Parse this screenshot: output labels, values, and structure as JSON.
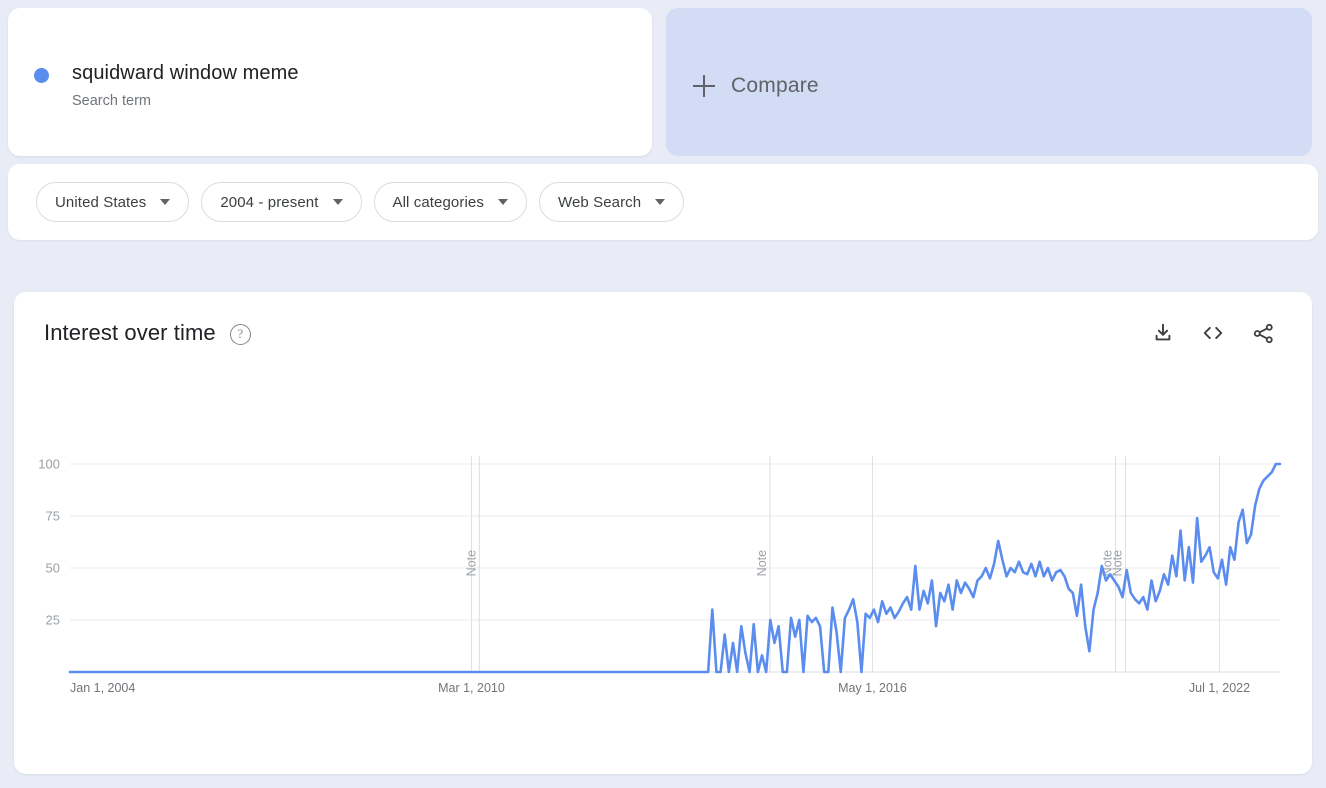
{
  "search_card": {
    "term": "squidward window meme",
    "type_label": "Search term",
    "dot_color": "#5b8def"
  },
  "compare_card": {
    "label": "Compare",
    "plus_icon": "plus-icon",
    "background": "#d2ddf5"
  },
  "filters": [
    {
      "label": "United States",
      "icon": "chevron-down-icon"
    },
    {
      "label": "2004 - present",
      "icon": "chevron-down-icon"
    },
    {
      "label": "All categories",
      "icon": "chevron-down-icon"
    },
    {
      "label": "Web Search",
      "icon": "chevron-down-icon"
    }
  ],
  "chart_card": {
    "title": "Interest over time",
    "help_icon": "help-icon",
    "help_glyph": "?",
    "actions": [
      {
        "name": "download-icon",
        "label": "Download"
      },
      {
        "name": "embed-icon",
        "label": "Embed"
      },
      {
        "name": "share-icon",
        "label": "Share"
      }
    ]
  },
  "chart_data": {
    "type": "line",
    "title": "Interest over time",
    "xlabel": "",
    "ylabel": "",
    "ylim": [
      0,
      100
    ],
    "yticks": [
      25,
      50,
      75,
      100
    ],
    "ytick_labels": [
      "25",
      "50",
      "75",
      "100"
    ],
    "xtick_labels": [
      "Jan 1, 2004",
      "Mar 1, 2010",
      "May 1, 2016",
      "Jul 1, 2022"
    ],
    "xtick_positions": [
      0,
      0.3318,
      0.6632,
      0.95
    ],
    "grid": true,
    "legend": "none",
    "line_color": "#5b8def",
    "line_width": 2.6,
    "annotations": [
      {
        "label": "Note",
        "x_frac": 0.3383
      },
      {
        "label": "Note",
        "x_frac": 0.5785
      },
      {
        "label": "Note",
        "x_frac": 0.8641
      },
      {
        "label": "Note",
        "x_frac": 0.8724
      }
    ],
    "series": [
      {
        "name": "squidward window meme",
        "values": [
          0,
          0,
          0,
          0,
          0,
          0,
          0,
          0,
          0,
          0,
          0,
          0,
          0,
          0,
          0,
          0,
          0,
          0,
          0,
          0,
          0,
          0,
          0,
          0,
          0,
          0,
          0,
          0,
          0,
          0,
          0,
          0,
          0,
          0,
          0,
          0,
          0,
          0,
          0,
          0,
          0,
          0,
          0,
          0,
          0,
          0,
          0,
          0,
          0,
          0,
          0,
          0,
          0,
          0,
          0,
          0,
          0,
          0,
          0,
          0,
          0,
          0,
          0,
          0,
          0,
          0,
          0,
          0,
          0,
          0,
          0,
          0,
          0,
          0,
          0,
          0,
          0,
          0,
          0,
          0,
          0,
          0,
          0,
          0,
          0,
          0,
          0,
          0,
          0,
          0,
          0,
          0,
          0,
          0,
          0,
          0,
          0,
          0,
          0,
          0,
          0,
          0,
          0,
          0,
          0,
          0,
          0,
          0,
          0,
          0,
          0,
          0,
          0,
          0,
          0,
          0,
          0,
          0,
          0,
          0,
          0,
          0,
          0,
          0,
          0,
          0,
          0,
          0,
          0,
          0,
          0,
          0,
          0,
          0,
          0,
          0,
          0,
          0,
          0,
          0,
          0,
          0,
          0,
          0,
          0,
          0,
          0,
          0,
          0,
          0,
          0,
          0,
          0,
          0,
          0,
          30,
          0,
          0,
          18,
          0,
          14,
          0,
          22,
          9,
          0,
          23,
          0,
          8,
          0,
          25,
          14,
          22,
          0,
          0,
          26,
          17,
          25,
          0,
          27,
          24,
          26,
          22,
          0,
          0,
          31,
          19,
          0,
          26,
          30,
          35,
          24,
          0,
          28,
          26,
          30,
          24,
          34,
          28,
          31,
          26,
          29,
          33,
          36,
          30,
          51,
          30,
          39,
          33,
          44,
          22,
          38,
          34,
          42,
          30,
          44,
          38,
          43,
          40,
          36,
          44,
          46,
          50,
          45,
          52,
          63,
          54,
          46,
          50,
          48,
          53,
          48,
          47,
          52,
          46,
          53,
          46,
          50,
          44,
          48,
          49,
          46,
          40,
          38,
          27,
          42,
          22,
          10,
          30,
          38,
          51,
          44,
          47,
          44,
          41,
          36,
          49,
          38,
          35,
          33,
          36,
          30,
          44,
          34,
          39,
          47,
          42,
          56,
          46,
          68,
          44,
          60,
          43,
          74,
          53,
          56,
          60,
          48,
          45,
          54,
          42,
          60,
          54,
          72,
          78,
          62,
          66,
          80,
          88,
          92,
          94,
          96,
          100,
          100
        ]
      }
    ]
  }
}
